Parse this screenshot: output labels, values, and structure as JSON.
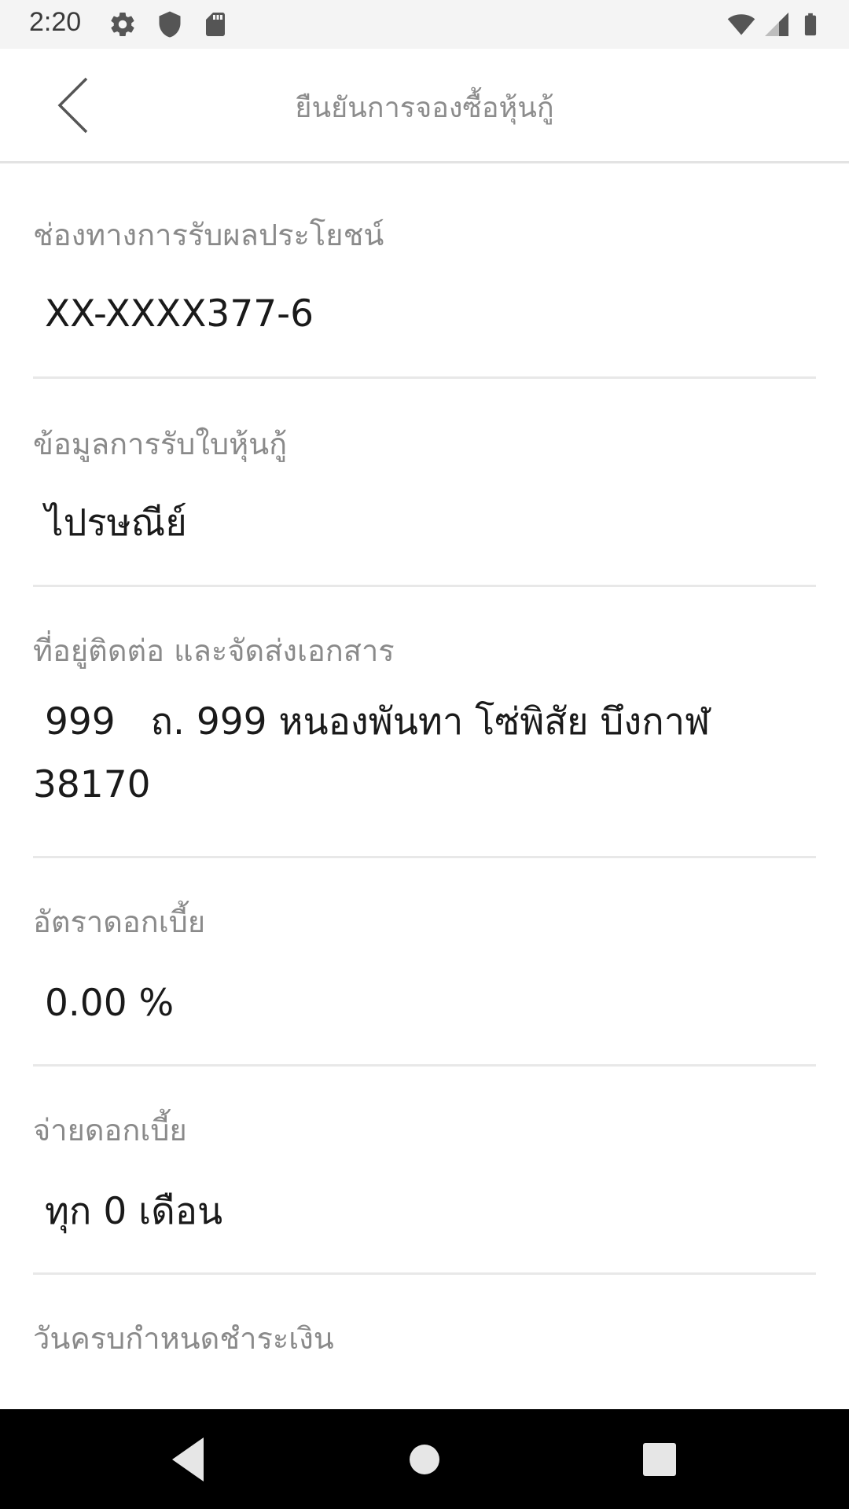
{
  "status_bar": {
    "time": "2:20",
    "icons": [
      "gear-icon",
      "shield-icon",
      "sd-card-icon",
      "wifi-icon",
      "signal-icon",
      "battery-icon"
    ]
  },
  "header": {
    "title": "ยืนยันการจองซื้อหุ้นกู้",
    "back_icon": "chevron-left-icon"
  },
  "fields": [
    {
      "label": "ช่องทางการรับผลประโยชน์",
      "value": " XX-XXXX377-6"
    },
    {
      "label": "ข้อมูลการรับใบหุ้นกู้",
      "value": " ไปรษณีย์"
    },
    {
      "label": "ที่อยู่ติดต่อ และจัดส่งเอกสาร",
      "value": " 999   ถ. 999 หนองพันทา โซ่พิสัย บึงกาฬ 38170"
    },
    {
      "label": "อัตราดอกเบี้ย",
      "value": " 0.00 %"
    },
    {
      "label": "จ่ายดอกเบี้ย",
      "value": " ทุก 0 เดือน"
    },
    {
      "label": "วันครบกำหนดชำระเงิน",
      "value": ""
    }
  ],
  "nav_bar": {
    "icons": [
      "back-triangle-icon",
      "home-circle-icon",
      "recents-square-icon"
    ]
  },
  "colors": {
    "status_bar_bg": "#f4f4f4",
    "label": "#8a8a8a",
    "value": "#1a1a1a",
    "divider": "#e8e8e8",
    "nav_bar_bg": "#000000"
  }
}
